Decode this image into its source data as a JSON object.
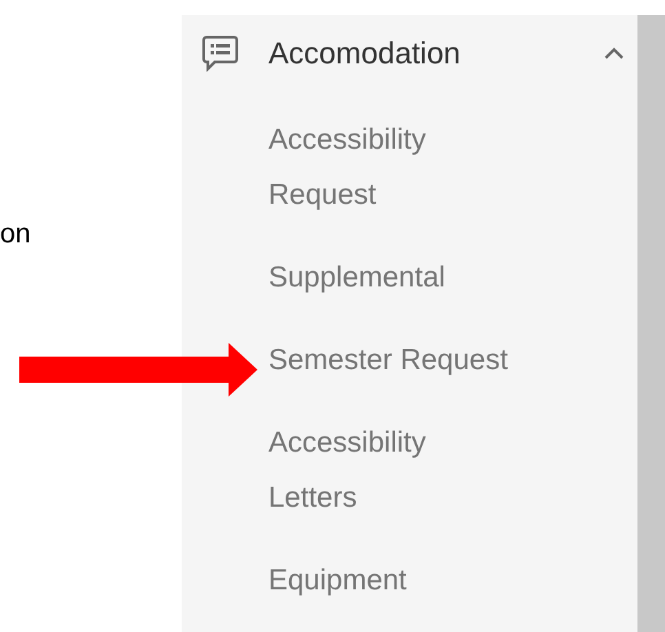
{
  "background_text": "on",
  "sidebar": {
    "section": {
      "label": "Accomodation",
      "expanded": true
    },
    "items": [
      {
        "label": "Accessibility Request"
      },
      {
        "label": "Supplemental"
      },
      {
        "label": "Semester Request"
      },
      {
        "label": "Accessibility Letters"
      },
      {
        "label": "Equipment"
      }
    ]
  }
}
